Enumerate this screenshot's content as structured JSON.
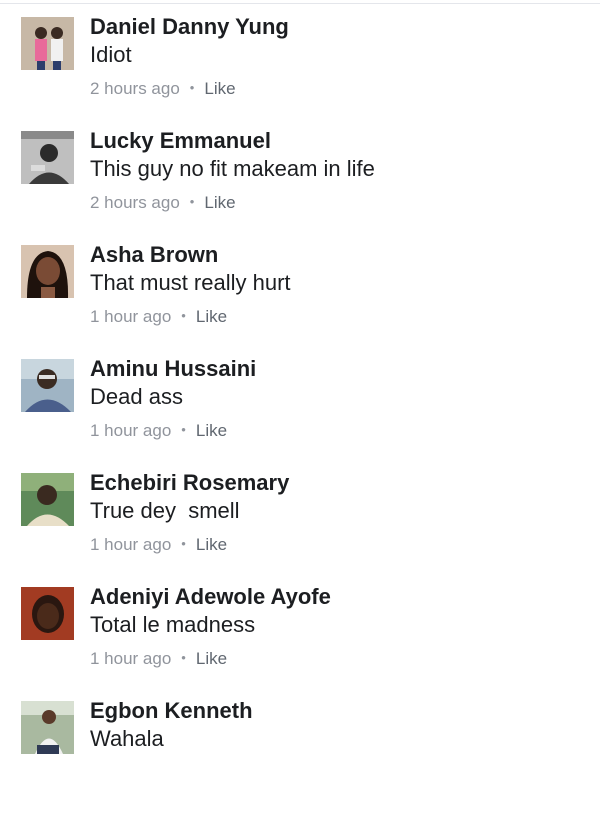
{
  "comments": [
    {
      "author": "Daniel Danny Yung",
      "text": "Idiot",
      "time": "2 hours ago",
      "action": "Like",
      "dot": "•",
      "avatar_bg": "#c7b8a6",
      "avatar_fg": "#e86a9a"
    },
    {
      "author": "Lucky Emmanuel",
      "text": "This guy no fit makeam in life",
      "time": "2 hours ago",
      "action": "Like",
      "dot": "•",
      "avatar_bg": "#bfbfbf",
      "avatar_fg": "#2b2b2b"
    },
    {
      "author": "Asha Brown",
      "text": "That must really hurt",
      "time": "1 hour ago",
      "action": "Like",
      "dot": "•",
      "avatar_bg": "#b99a84",
      "avatar_fg": "#2a1a14"
    },
    {
      "author": "Aminu Hussaini",
      "text": "Dead ass",
      "time": "1 hour ago",
      "action": "Like",
      "dot": "•",
      "avatar_bg": "#9fb4c4",
      "avatar_fg": "#3a2b22"
    },
    {
      "author": "Echebiri Rosemary",
      "text": "True dey  smell",
      "time": "1 hour ago",
      "action": "Like",
      "dot": "•",
      "avatar_bg": "#5f8a5a",
      "avatar_fg": "#3a2a20"
    },
    {
      "author": "Adeniyi Adewole Ayofe",
      "text": "Total le madness",
      "time": "1 hour ago",
      "action": "Like",
      "dot": "•",
      "avatar_bg": "#a23b22",
      "avatar_fg": "#2a1710"
    },
    {
      "author": "Egbon Kenneth",
      "text": "Wahala",
      "time": "",
      "action": "",
      "dot": "",
      "avatar_bg": "#a9b9a0",
      "avatar_fg": "#5a3a2a"
    }
  ]
}
